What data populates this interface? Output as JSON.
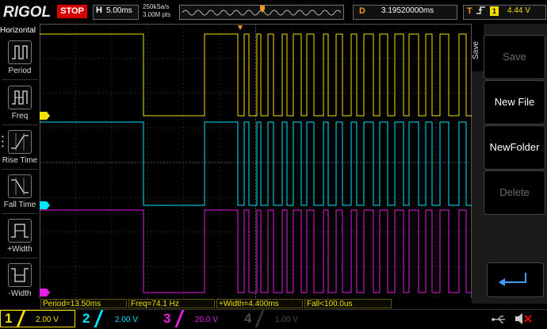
{
  "header": {
    "brand": "RIGOL",
    "run_status": "STOP",
    "timebase_letter": "H",
    "timebase": "5.00ms",
    "sample_rate": "250kSa/s",
    "memory_depth": "3.00M pts",
    "delay_letter": "D",
    "delay": "3.19520000ms",
    "trigger_letter": "T",
    "trigger_source": "1",
    "trigger_level": "4.44 V"
  },
  "left_menu": {
    "title": "Horizontal",
    "items": [
      {
        "label": "Period"
      },
      {
        "label": "Freq"
      },
      {
        "label": "Rise Time"
      },
      {
        "label": "Fall Time"
      },
      {
        "label": "+Width"
      },
      {
        "label": "-Width"
      }
    ]
  },
  "right_menu": {
    "side_label": "Save",
    "buttons": [
      {
        "label": "Save",
        "enabled": false
      },
      {
        "label": "New File",
        "enabled": true
      },
      {
        "label": "NewFolder",
        "enabled": true
      },
      {
        "label": "Delete",
        "enabled": false
      }
    ]
  },
  "measurements": [
    {
      "text": "Period=13.50ms"
    },
    {
      "text": "Freq=74.1 Hz"
    },
    {
      "text": "+Width=4.400ms"
    },
    {
      "text": "Fall<100.0us"
    }
  ],
  "channels": [
    {
      "num": "1",
      "scale": "2.00 V",
      "color": "#f5e000",
      "active": true
    },
    {
      "num": "2",
      "scale": "2.00 V",
      "color": "#00e5ff",
      "active": true
    },
    {
      "num": "3",
      "scale": "20.0 V",
      "color": "#e61ee6",
      "active": true
    },
    {
      "num": "4",
      "scale": "1.00 V",
      "color": "#3050ff",
      "active": false
    }
  ],
  "colors": {
    "ch1": "#f5e000",
    "ch2": "#00e5ff",
    "ch3": "#e61ee6",
    "ch4": "#3050ff",
    "accent": "#f39a1c",
    "stop": "#d50000"
  }
}
